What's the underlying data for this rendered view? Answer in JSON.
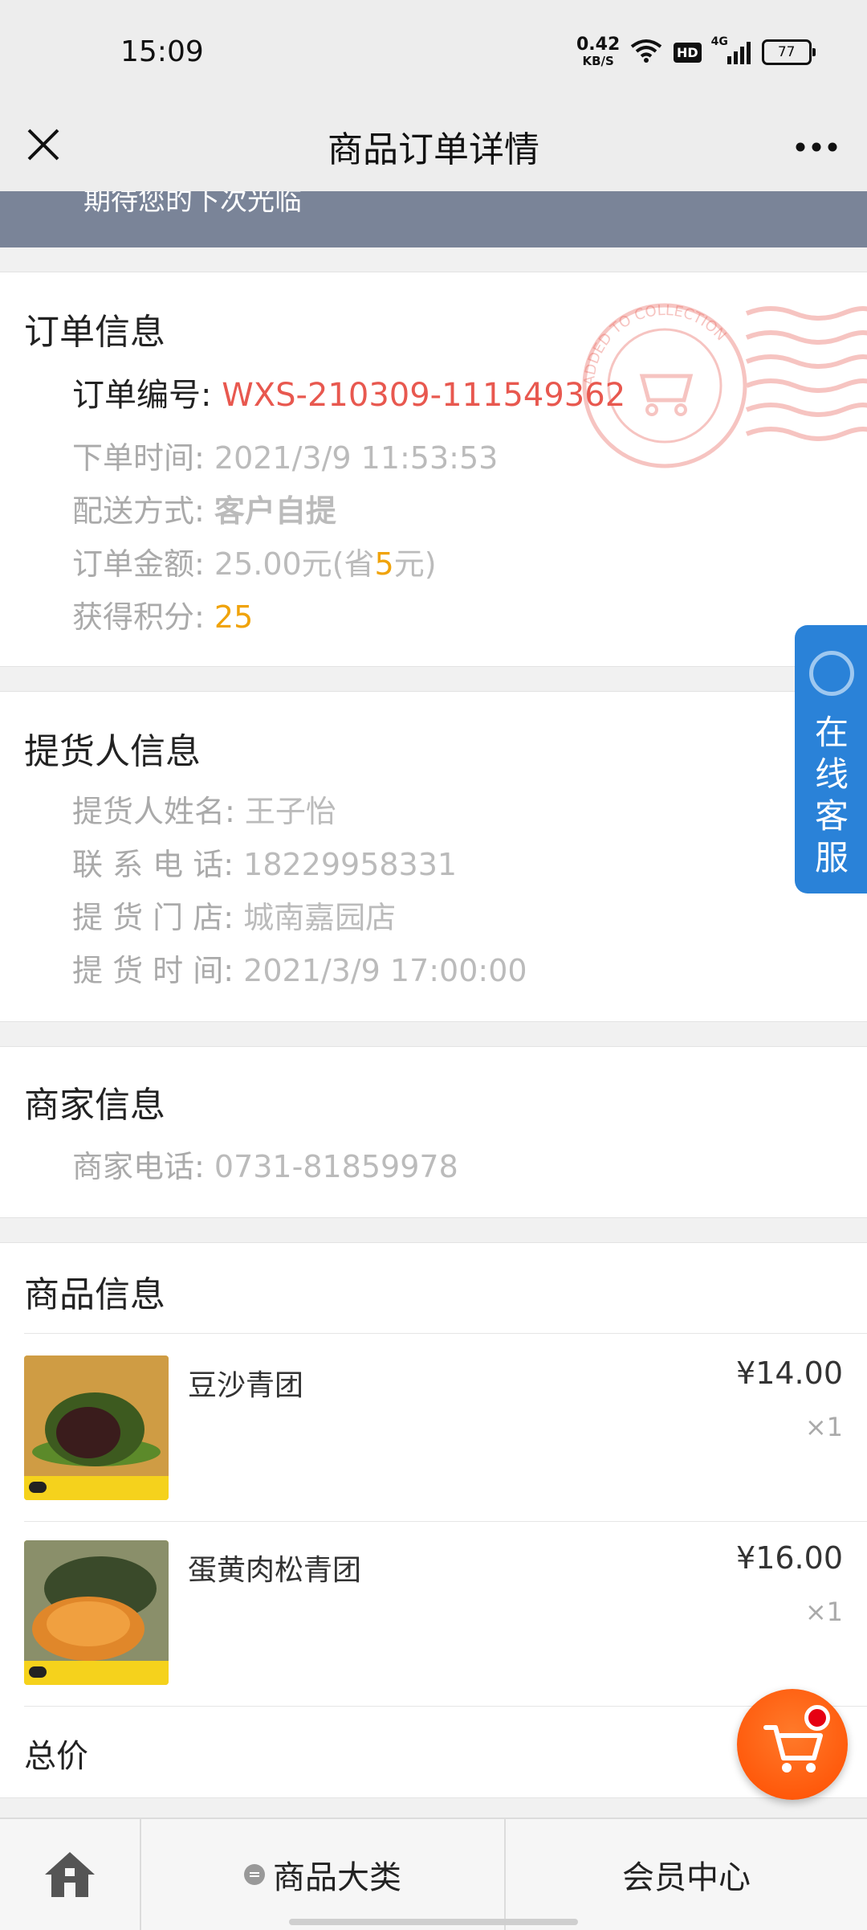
{
  "status_bar": {
    "time": "15:09",
    "net_speed": "0.42",
    "net_unit": "KB/S",
    "hd": "HD",
    "network": "4G",
    "battery": "77"
  },
  "nav": {
    "title": "商品订单详情"
  },
  "banner": {
    "text": "期待您的下次光临"
  },
  "order_info": {
    "title": "订单信息",
    "number_label": "订单编号:",
    "number_value": "WXS-210309-111549362",
    "time_label": "下单时间:",
    "time_value": "2021/3/9 11:53:53",
    "delivery_label": "配送方式:",
    "delivery_value": "客户自提",
    "amount_label": "订单金额:",
    "amount_prefix": "25.00元(省",
    "amount_saved": "5",
    "amount_suffix": "元)",
    "points_label": "获得积分:",
    "points_value": "25"
  },
  "pickup_info": {
    "title": "提货人信息",
    "name_label": "提货人姓名:",
    "name_value": "王子怡",
    "phone_label": "联 系 电 话:",
    "phone_value": "18229958331",
    "store_label": "提 货 门 店:",
    "store_value": "城南嘉园店",
    "time_label": "提 货 时 间:",
    "time_value": "2021/3/9 17:00:00"
  },
  "merchant_info": {
    "title": "商家信息",
    "phone_label": "商家电话:",
    "phone_value": "0731-81859978"
  },
  "product_info": {
    "title": "商品信息",
    "items": [
      {
        "name": "豆沙青团",
        "price": "¥14.00",
        "qty": "×1"
      },
      {
        "name": "蛋黄肉松青团",
        "price": "¥16.00",
        "qty": "×1"
      }
    ],
    "total_label": "总价"
  },
  "stamp": {
    "text": "ADDED TO COLLECTION"
  },
  "customer_service": {
    "label": "在线客服"
  },
  "tabbar": {
    "category_label": "商品大类",
    "member_label": "会员中心"
  },
  "colors": {
    "order_number": "#e8584f",
    "highlight": "#f0a30a",
    "cs_blue": "#2a82d8",
    "cart_orange": "#ff5a10",
    "banner": "#7a8498"
  }
}
